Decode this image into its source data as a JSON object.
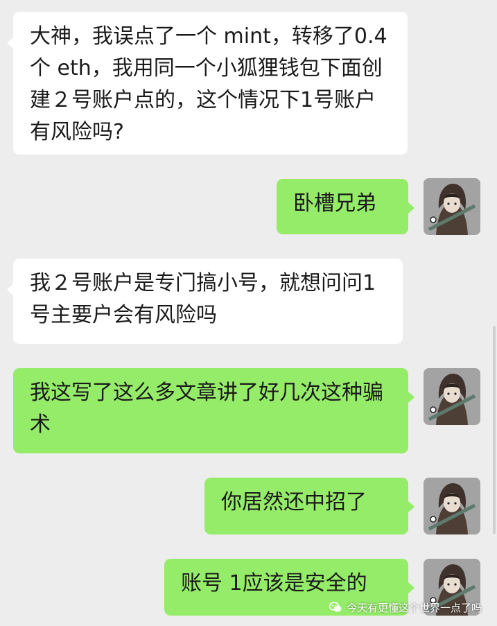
{
  "conversation": {
    "messages": [
      {
        "direction": "incoming",
        "text": "大神，我误点了一个 mint，转移了0.4个 eth，我用同一个小狐狸钱包下面创建２号账户点的，这个情况下1号账户有风险吗?"
      },
      {
        "direction": "outgoing",
        "text": "卧槽兄弟"
      },
      {
        "direction": "incoming",
        "text": "我２号账户是专门搞小号，就想问问1号主要户会有风险吗"
      },
      {
        "direction": "outgoing",
        "text": "我这写了这么多文章讲了好几次这种骗术"
      },
      {
        "direction": "outgoing",
        "text": "你居然还中招了"
      },
      {
        "direction": "outgoing",
        "text": "账号 1应该是安全的"
      }
    ]
  },
  "watermark": {
    "icon": "wechat-official-account-icon",
    "text": "今天有更懂这个世界一点了吗"
  },
  "colors": {
    "background": "#ededed",
    "incoming_bubble": "#ffffff",
    "outgoing_bubble": "#95ec69",
    "text": "#1a1a1a"
  }
}
